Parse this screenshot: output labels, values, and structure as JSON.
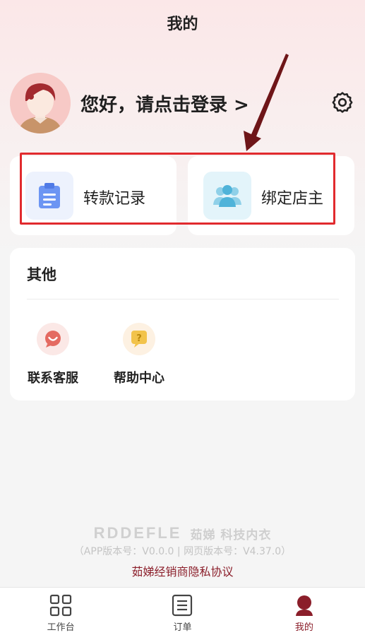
{
  "header": {
    "title": "我的"
  },
  "profile": {
    "login_prompt": "您好，请点击登录 >"
  },
  "quick_actions": [
    {
      "label": "转款记录",
      "icon": "clipboard-icon"
    },
    {
      "label": "绑定店主",
      "icon": "users-icon"
    }
  ],
  "other": {
    "title": "其他",
    "items": [
      {
        "label": "联系客服",
        "icon": "chat-bubble-icon"
      },
      {
        "label": "帮助中心",
        "icon": "help-question-icon"
      }
    ]
  },
  "footer": {
    "logo_text": "RDDEFLE",
    "logo_cn": "茹娣 科技内衣",
    "version": "（APP版本号：V0.0.0 | 网页版本号：V4.37.0）",
    "privacy_link": "茹娣经销商隐私协议"
  },
  "tabbar": {
    "items": [
      {
        "label": "工作台",
        "icon": "grid-icon"
      },
      {
        "label": "订单",
        "icon": "order-icon"
      },
      {
        "label": "我的",
        "icon": "person-icon",
        "active": true
      }
    ]
  },
  "colors": {
    "brand": "#8b1e2a",
    "highlight": "#e12a2e"
  }
}
